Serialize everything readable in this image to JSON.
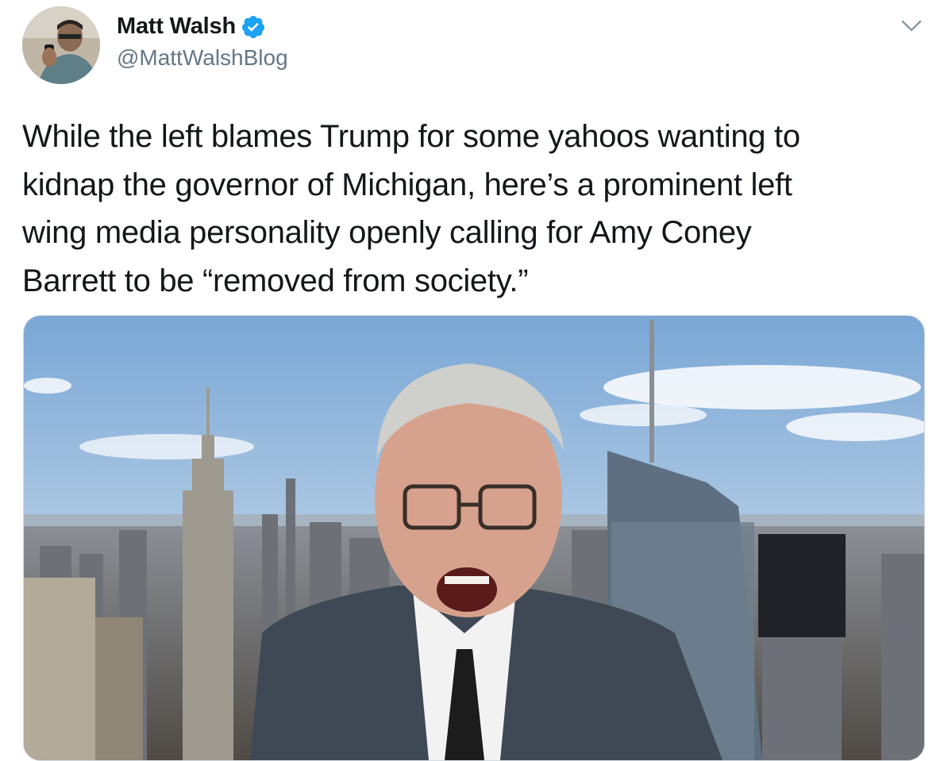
{
  "tweet": {
    "author": {
      "display_name": "Matt Walsh",
      "handle": "@MattWalshBlog",
      "verified": true,
      "avatar_icon": "profile-photo"
    },
    "menu_icon": "chevron-down-icon",
    "text": "While the left blames Trump for some yahoos wanting to\nkidnap the governor of Michigan, here’s a prominent left\nwing media personality openly calling for Amy Coney\nBarrett to be “removed from society.”",
    "media": {
      "type": "video-frame",
      "subject": "man-speaking-skyline-background"
    }
  },
  "colors": {
    "text_primary": "#14171a",
    "text_secondary": "#657786",
    "verified_blue": "#1da1f2",
    "border": "#d6dbe0"
  }
}
